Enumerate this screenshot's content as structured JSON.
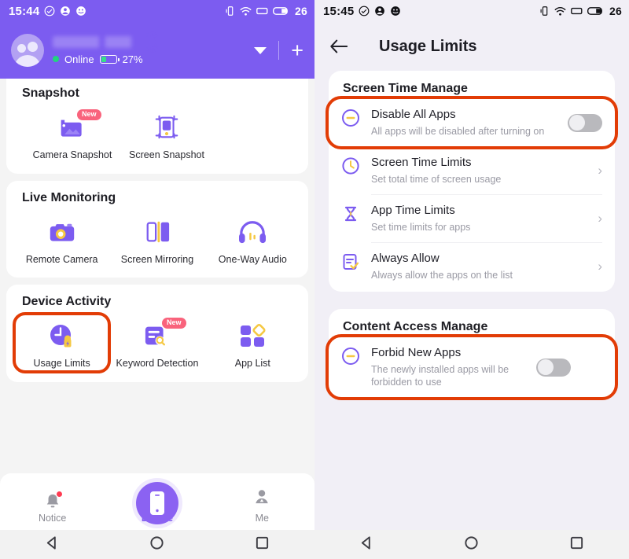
{
  "left": {
    "statusbar": {
      "time": "15:44",
      "battery_percent": "26",
      "icons": [
        "check-circle-icon",
        "account-circle-icon",
        "smiley-icon",
        "vibrate-icon",
        "wifi-icon",
        "signal-icon",
        "battery-icon"
      ]
    },
    "header": {
      "device_name": "",
      "status": "Online",
      "battery": "27%",
      "dropdown_icon": "chevron-down-icon",
      "add_icon": "plus-icon"
    },
    "sections": [
      {
        "title": "Snapshot",
        "tiles": [
          {
            "label": "Camera Snapshot",
            "icon": "camera-snapshot-icon",
            "badge": "New"
          },
          {
            "label": "Screen Snapshot",
            "icon": "screen-snapshot-icon",
            "badge": ""
          }
        ]
      },
      {
        "title": "Live Monitoring",
        "tiles": [
          {
            "label": "Remote Camera",
            "icon": "remote-camera-icon",
            "badge": ""
          },
          {
            "label": "Screen Mirroring",
            "icon": "screen-mirroring-icon",
            "badge": ""
          },
          {
            "label": "One-Way Audio",
            "icon": "one-way-audio-icon",
            "badge": ""
          }
        ]
      },
      {
        "title": "Device Activity",
        "tiles": [
          {
            "label": "Usage Limits",
            "icon": "usage-limits-icon",
            "badge": ""
          },
          {
            "label": "Keyword Detection",
            "icon": "keyword-detection-icon",
            "badge": "New"
          },
          {
            "label": "App List",
            "icon": "app-list-icon",
            "badge": ""
          }
        ]
      }
    ],
    "bottom_nav": [
      {
        "label": "Notice",
        "icon": "bell-icon",
        "active": false
      },
      {
        "label": "Device",
        "icon": "phone-icon",
        "active": true
      },
      {
        "label": "Me",
        "icon": "person-icon",
        "active": false
      }
    ]
  },
  "right": {
    "statusbar": {
      "time": "15:45",
      "battery_percent": "26"
    },
    "appbar": {
      "back_icon": "back-arrow-icon",
      "title": "Usage Limits"
    },
    "sections": [
      {
        "title": "Screen Time Manage",
        "rows": [
          {
            "title": "Disable All Apps",
            "sub": "All apps will be disabled after turning on",
            "icon": "disable-circle-icon",
            "control": "toggle",
            "toggle_on": false,
            "highlighted": true
          },
          {
            "title": "Screen Time Limits",
            "sub": "Set total time of screen usage",
            "icon": "clock-icon",
            "control": "chevron",
            "highlighted": false
          },
          {
            "title": "App Time Limits",
            "sub": "Set time limits for apps",
            "icon": "hourglass-icon",
            "control": "chevron",
            "highlighted": false
          },
          {
            "title": "Always Allow",
            "sub": "Always allow the apps on the list",
            "icon": "allow-list-icon",
            "control": "chevron",
            "highlighted": false
          }
        ]
      },
      {
        "title": "Content Access Manage",
        "rows": [
          {
            "title": "Forbid New Apps",
            "sub": "The newly installed apps will be forbidden to use",
            "icon": "disable-circle-icon",
            "control": "toggle",
            "toggle_on": false,
            "highlighted": true
          }
        ]
      }
    ]
  },
  "android_nav": {
    "back": "back-triangle-icon",
    "home": "home-circle-icon",
    "recents": "recents-square-icon"
  },
  "colors": {
    "brand_purple": "#7c5cf0",
    "accent_yellow": "#f5c842",
    "highlight_red": "#e23c06",
    "badge_pink": "#f9637c",
    "online_green": "#22d37f"
  }
}
